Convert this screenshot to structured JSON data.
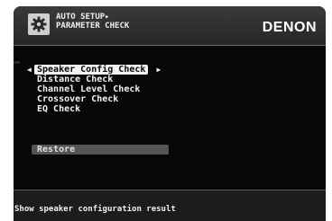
{
  "header": {
    "breadcrumb_line1": "AUTO SETUP▸",
    "breadcrumb_line2": "PARAMETER CHECK",
    "brand": "DENON",
    "icon": "gear-icon"
  },
  "menu": {
    "items": [
      {
        "label": "Speaker Config Check",
        "selected": true
      },
      {
        "label": "Distance Check",
        "selected": false
      },
      {
        "label": "Channel Level Check",
        "selected": false
      },
      {
        "label": "Crossover Check",
        "selected": false
      },
      {
        "label": "EQ Check",
        "selected": false
      }
    ],
    "restore_label": "Restore"
  },
  "status": {
    "text": "Show speaker configuration result"
  },
  "colors": {
    "background": "#070707",
    "text": "#f2f2f2",
    "selected_bg": "#f2f2f2",
    "restore_bg": "#545454"
  }
}
